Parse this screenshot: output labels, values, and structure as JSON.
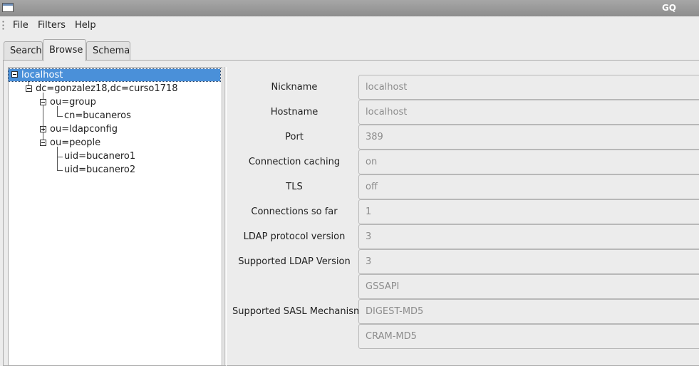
{
  "window": {
    "title": "GQ",
    "icon": "window-icon"
  },
  "menu": {
    "file": "File",
    "filters": "Filters",
    "help": "Help"
  },
  "tabs": {
    "search": "Search",
    "browse": "Browse",
    "schema": "Schema",
    "active": "Browse"
  },
  "tree": {
    "root": "localhost",
    "base": "dc=gonzalez18,dc=curso1718",
    "group": "ou=group",
    "group_child": "cn=bucaneros",
    "ldapconfig": "ou=ldapconfig",
    "people": "ou=people",
    "people_child1": "uid=bucanero1",
    "people_child2": "uid=bucanero2"
  },
  "server": {
    "labels": {
      "nickname": "Nickname",
      "hostname": "Hostname",
      "port": "Port",
      "connection_caching": "Connection caching",
      "tls": "TLS",
      "connections_so_far": "Connections so far",
      "ldap_protocol_version": "LDAP protocol version",
      "supported_ldap_version": "Supported LDAP Version",
      "supported_sasl_mechanisms": "Supported SASL Mechanisms"
    },
    "values": {
      "nickname": "localhost",
      "hostname": "localhost",
      "port": "389",
      "connection_caching": "on",
      "tls": "off",
      "connections_so_far": "1",
      "ldap_protocol_version": "3",
      "supported_ldap_version": "3",
      "sasl_1": "GSSAPI",
      "sasl_2": "DIGEST-MD5",
      "sasl_3": "CRAM-MD5"
    }
  }
}
